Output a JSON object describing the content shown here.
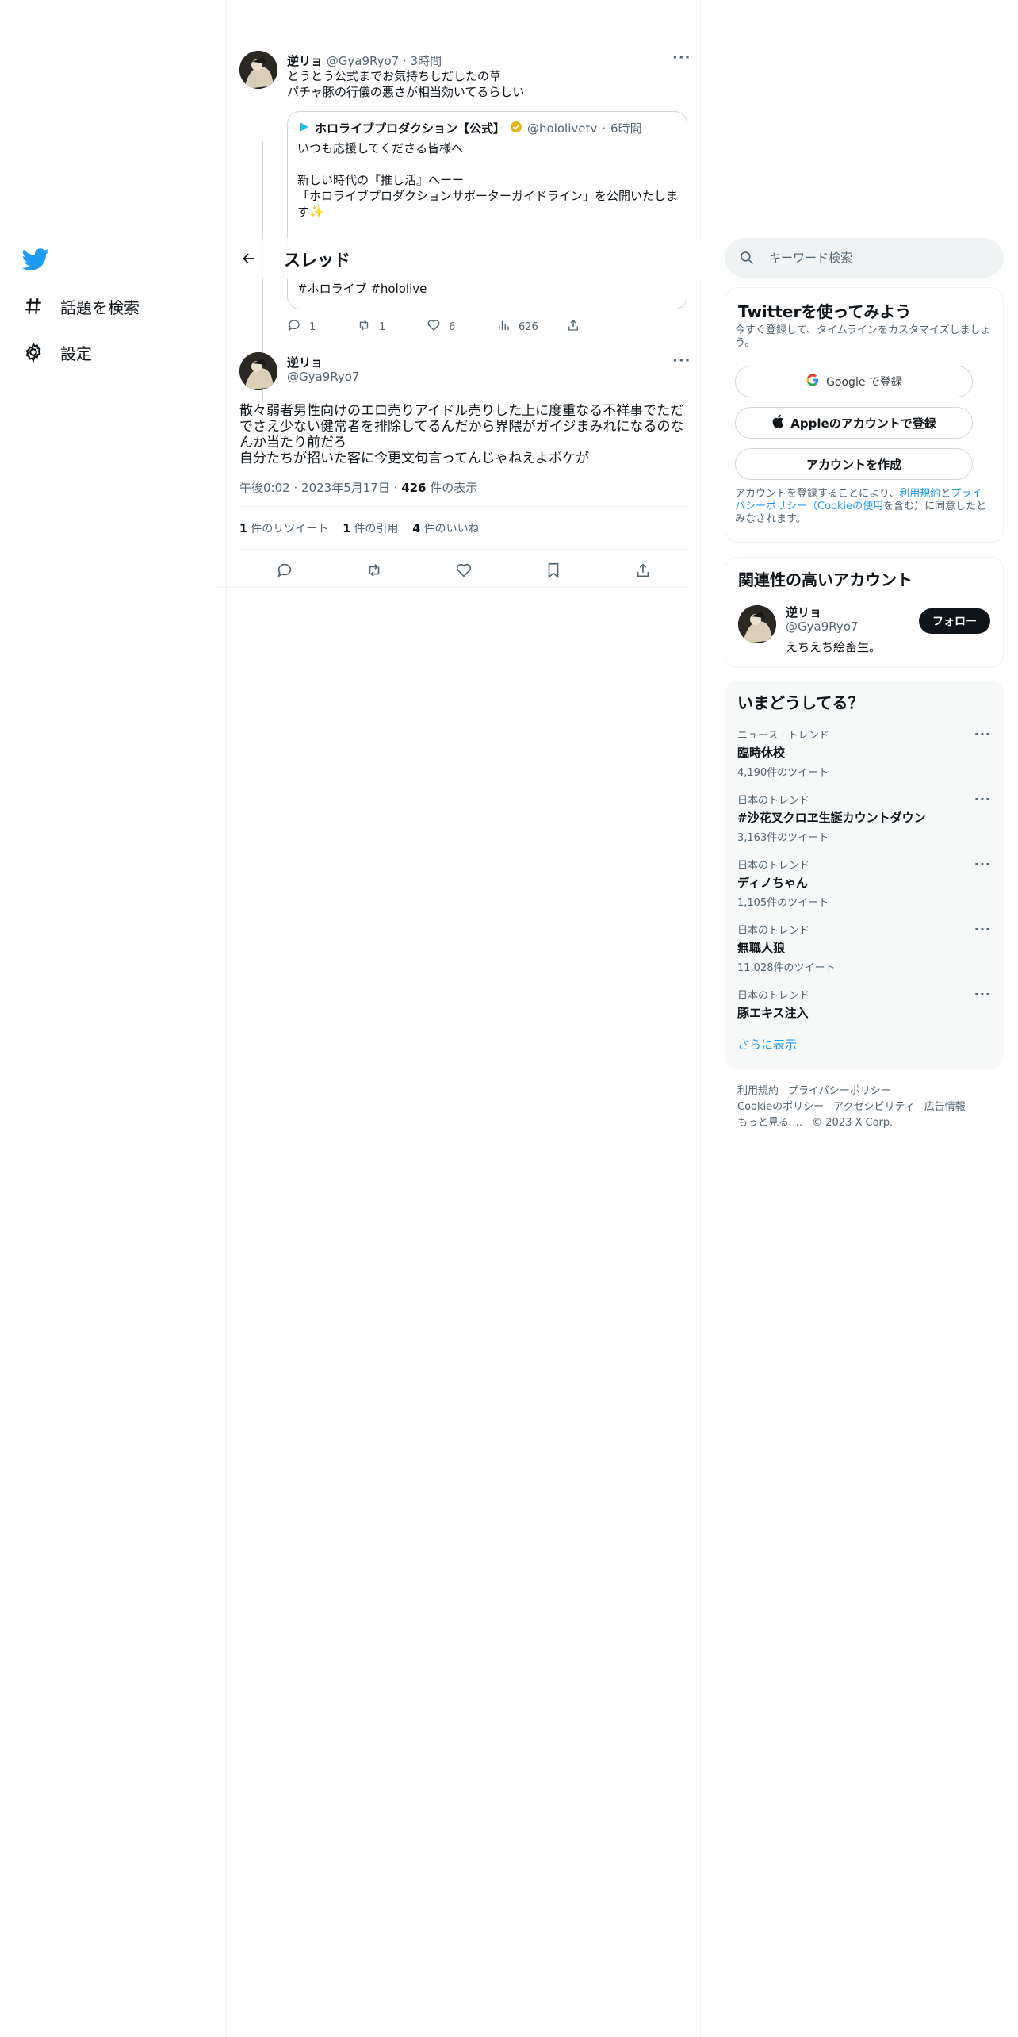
{
  "nav": {
    "explore_label": "話題を検索",
    "settings_label": "設定"
  },
  "header": {
    "title": "スレッド"
  },
  "parent_tweet": {
    "name": "逆リョ",
    "handle": "@Gya9Ryo7",
    "sep": "·",
    "time": "3時間",
    "text": "とうとう公式までお気持ちしだしたの草\nパチャ豚の行儀の悪さが相当効いてるらしい",
    "quote": {
      "name": "ホロライブプロダクション【公式】",
      "handle": "@hololivetv",
      "sep": "·",
      "time": "6時間",
      "text": "いつも応援してくださる皆様へ\n\n新しい時代の『推し活』へーー\n「ホロライブプロダクションサポーターガイドライン」を公開いたしま す✨",
      "hashtags": "#ホロライブ #hololive"
    },
    "actions": {
      "replies": "1",
      "retweets": "1",
      "likes": "6",
      "views": "626"
    }
  },
  "main_tweet": {
    "name": "逆リョ",
    "handle": "@Gya9Ryo7",
    "text": "散々弱者男性向けのエロ売りアイドル売りした上に度重なる不祥事でただでさえ少ない健常者を排除してるんだから界隈がガイジまみれになるのなんか当たり前だろ\n自分たちが招いた客に今更文句言ってんじゃねえよボケが",
    "time": "午後0:02",
    "sep1": "·",
    "date": "2023年5月17日",
    "sep2": "·",
    "views_count": "426",
    "views_label": "件の表示",
    "stats": {
      "retweets_count": "1",
      "retweets_label": "件のリツイート",
      "quotes_count": "1",
      "quotes_label": "件の引用",
      "likes_count": "4",
      "likes_label": "件のいいね"
    }
  },
  "search": {
    "placeholder": "キーワード検索"
  },
  "signup": {
    "title": "Twitterを使ってみよう",
    "desc": "今すぐ登録して、タイムラインをカスタマイズしましょう。",
    "google_label": "Google で登録",
    "apple_label": "Appleのアカウントで登録",
    "create_label": "アカウントを作成",
    "legal_prefix": "アカウントを登録することにより、",
    "legal_terms": "利用規約",
    "legal_and": "と",
    "legal_privacy": "プライバシーポリシー（Cookieの使用",
    "legal_suffix": "を含む）に同意したとみなされます。"
  },
  "related": {
    "title": "関連性の高いアカウント",
    "name": "逆リョ",
    "handle": "@Gya9Ryo7",
    "bio": "えちえち絵畜生。",
    "follow_label": "フォロー"
  },
  "trends": {
    "title": "いまどうしてる？",
    "items": [
      {
        "context": "ニュース · トレンド",
        "name": "臨時休校",
        "count": "4,190件のツイート"
      },
      {
        "context": "日本のトレンド",
        "name": "#沙花叉クロヱ生誕カウントダウン",
        "count": "3,163件のツイート"
      },
      {
        "context": "日本のトレンド",
        "name": "ディノちゃん",
        "count": "1,105件のツイート"
      },
      {
        "context": "日本のトレンド",
        "name": "無職人狼",
        "count": "11,028件のツイート"
      },
      {
        "context": "日本のトレンド",
        "name": "豚エキス注入",
        "count": ""
      }
    ],
    "show_more": "さらに表示"
  },
  "footer": {
    "links": [
      "利用規約",
      "プライバシーポリシー",
      "Cookieのポリシー",
      "アクセシビリティ",
      "広告情報",
      "もっと見る …",
      "© 2023 X Corp."
    ]
  },
  "colors": {
    "accent": "#1d9bf0",
    "text": "#0f1419",
    "secondary": "#536471",
    "border": "#eff3f4"
  }
}
